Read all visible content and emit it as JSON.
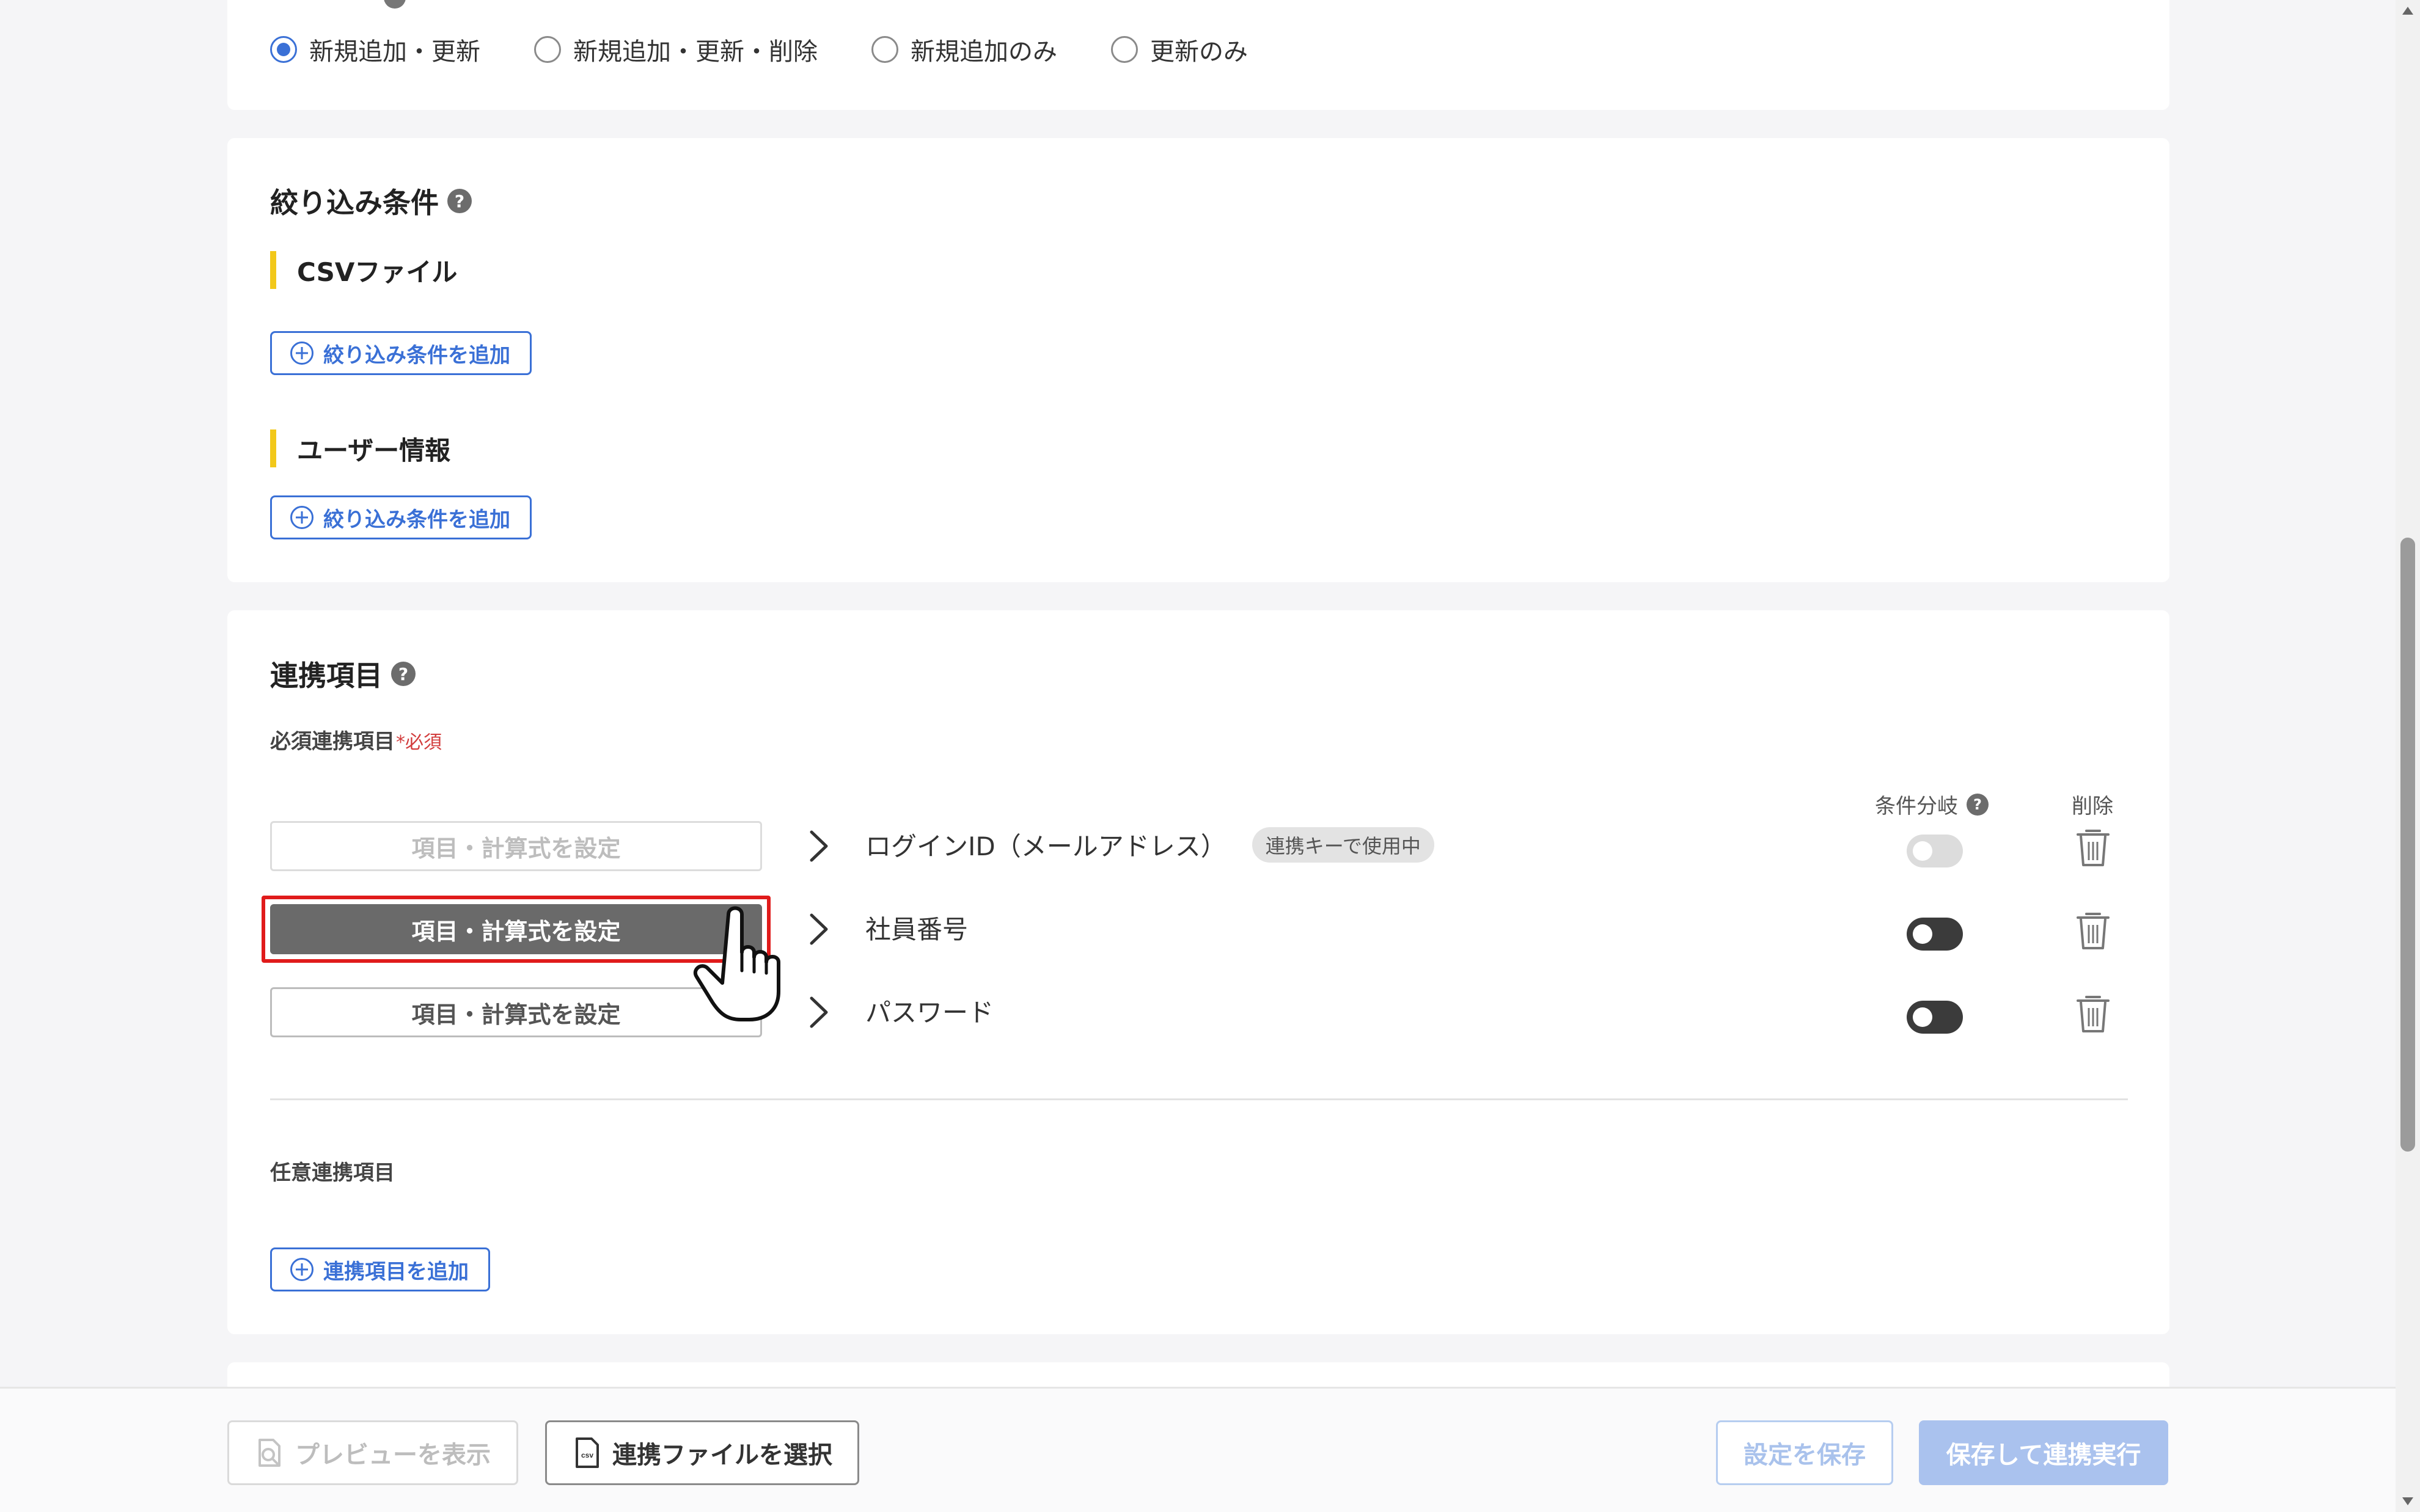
{
  "sync_mode": {
    "options": [
      "新規追加・更新",
      "新規追加・更新・削除",
      "新規追加のみ",
      "更新のみ"
    ],
    "selected": "新規追加・更新"
  },
  "filter_section": {
    "title": "絞り込み条件",
    "help": "?",
    "csv_heading": "CSVファイル",
    "user_heading": "ユーザー情報",
    "add_label": "絞り込み条件を追加"
  },
  "mapping_section": {
    "title": "連携項目",
    "help": "?",
    "required_label": "必須連携項目",
    "required_mark": "*必須",
    "col_condition": "条件分岐",
    "col_delete": "削除",
    "rows": [
      {
        "button_label": "項目・計算式を設定",
        "target": "ログインID（メールアドレス）",
        "badge": "連携キーで使用中",
        "state": "disabled"
      },
      {
        "button_label": "項目・計算式を設定",
        "target": "社員番号",
        "badge": "",
        "state": "active"
      },
      {
        "button_label": "項目・計算式を設定",
        "target": "パスワード",
        "badge": "",
        "state": "normal"
      }
    ],
    "optional_label": "任意連携項目",
    "add_mapping_label": "連携項目を追加"
  },
  "footer": {
    "preview_label": "プレビューを表示",
    "file_label": "連携ファイルを選択",
    "save_label": "設定を保存",
    "run_label": "保存して連携実行"
  },
  "colors": {
    "accent": "#3a70d6",
    "highlight": "#e01b1b",
    "heading_bar": "#f2c81a"
  },
  "icons": {
    "help": "help-icon",
    "plus": "plus-circle-icon",
    "chevron": "chevron-right-icon",
    "trash": "trash-icon",
    "preview": "search-document-icon",
    "csv": "csv-file-icon",
    "cursor": "hand-pointer-icon"
  }
}
